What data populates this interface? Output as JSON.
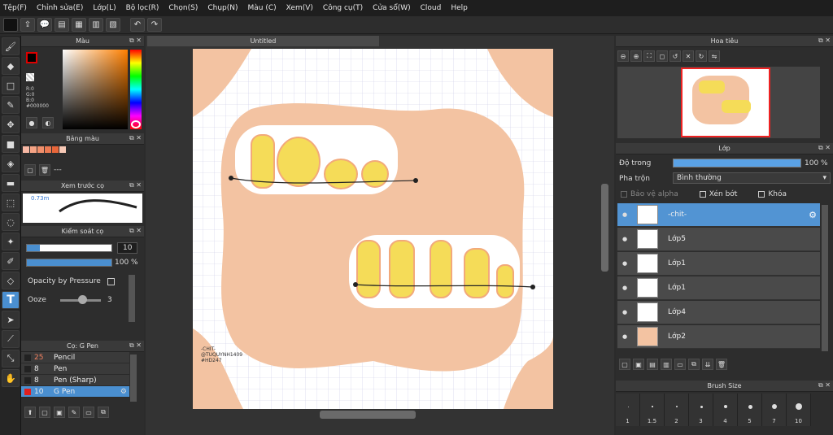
{
  "menu": [
    "Tệp(F)",
    "Chỉnh sửa(E)",
    "Lớp(L)",
    "Bộ lọc(R)",
    "Chọn(S)",
    "Chụp(N)",
    "Màu (C)",
    "Xem(V)",
    "Công cụ(T)",
    "Cửa sổ(W)",
    "Cloud",
    "Help"
  ],
  "color_panel": {
    "title": "Màu",
    "r": "R:0",
    "g": "G:0",
    "b": "B:0",
    "hex": "#000000"
  },
  "palette_panel": {
    "title": "Bảng màu",
    "swatches": [
      "#f7b7a3",
      "#f4a384",
      "#f08f6b",
      "#ec7a53",
      "#e8663a",
      "#f7c9b6"
    ],
    "dash": "---"
  },
  "brush_preview": {
    "title": "Xem trước cọ",
    "size": "0.73m"
  },
  "brush_control": {
    "title": "Kiểm soát cọ",
    "size_value": "10",
    "opacity_value": "100 %",
    "opacity_pressure": "Opacity by Pressure",
    "ooze_label": "Ooze",
    "ooze_value": "3"
  },
  "brush_list": {
    "title": "Cọ: G Pen",
    "items": [
      {
        "size": "25",
        "name": "Pencil"
      },
      {
        "size": "8",
        "name": "Pen"
      },
      {
        "size": "8",
        "name": "Pen (Sharp)"
      },
      {
        "size": "10",
        "name": "G Pen"
      }
    ]
  },
  "document": {
    "title": "Untitled",
    "signature": "-CHIT-\n@TUQUYNH1409\n#HD247"
  },
  "navigator": {
    "title": "Hoa tiêu"
  },
  "layer_panel": {
    "title": "Lớp",
    "opacity_label": "Độ trong",
    "opacity_value": "100 %",
    "blend_label": "Pha trộn",
    "blend_value": "Bình thường",
    "protect_alpha": "Bảo vệ alpha",
    "clipping": "Xén bớt",
    "lock": "Khóa",
    "layers": [
      "-chit-",
      "Lớp5",
      "Lớp1",
      "Lớp1",
      "Lớp4",
      "Lớp2"
    ]
  },
  "brush_size_panel": {
    "title": "Brush Size",
    "sizes": [
      "1",
      "1.5",
      "2",
      "3",
      "4",
      "5",
      "7",
      "10"
    ]
  }
}
